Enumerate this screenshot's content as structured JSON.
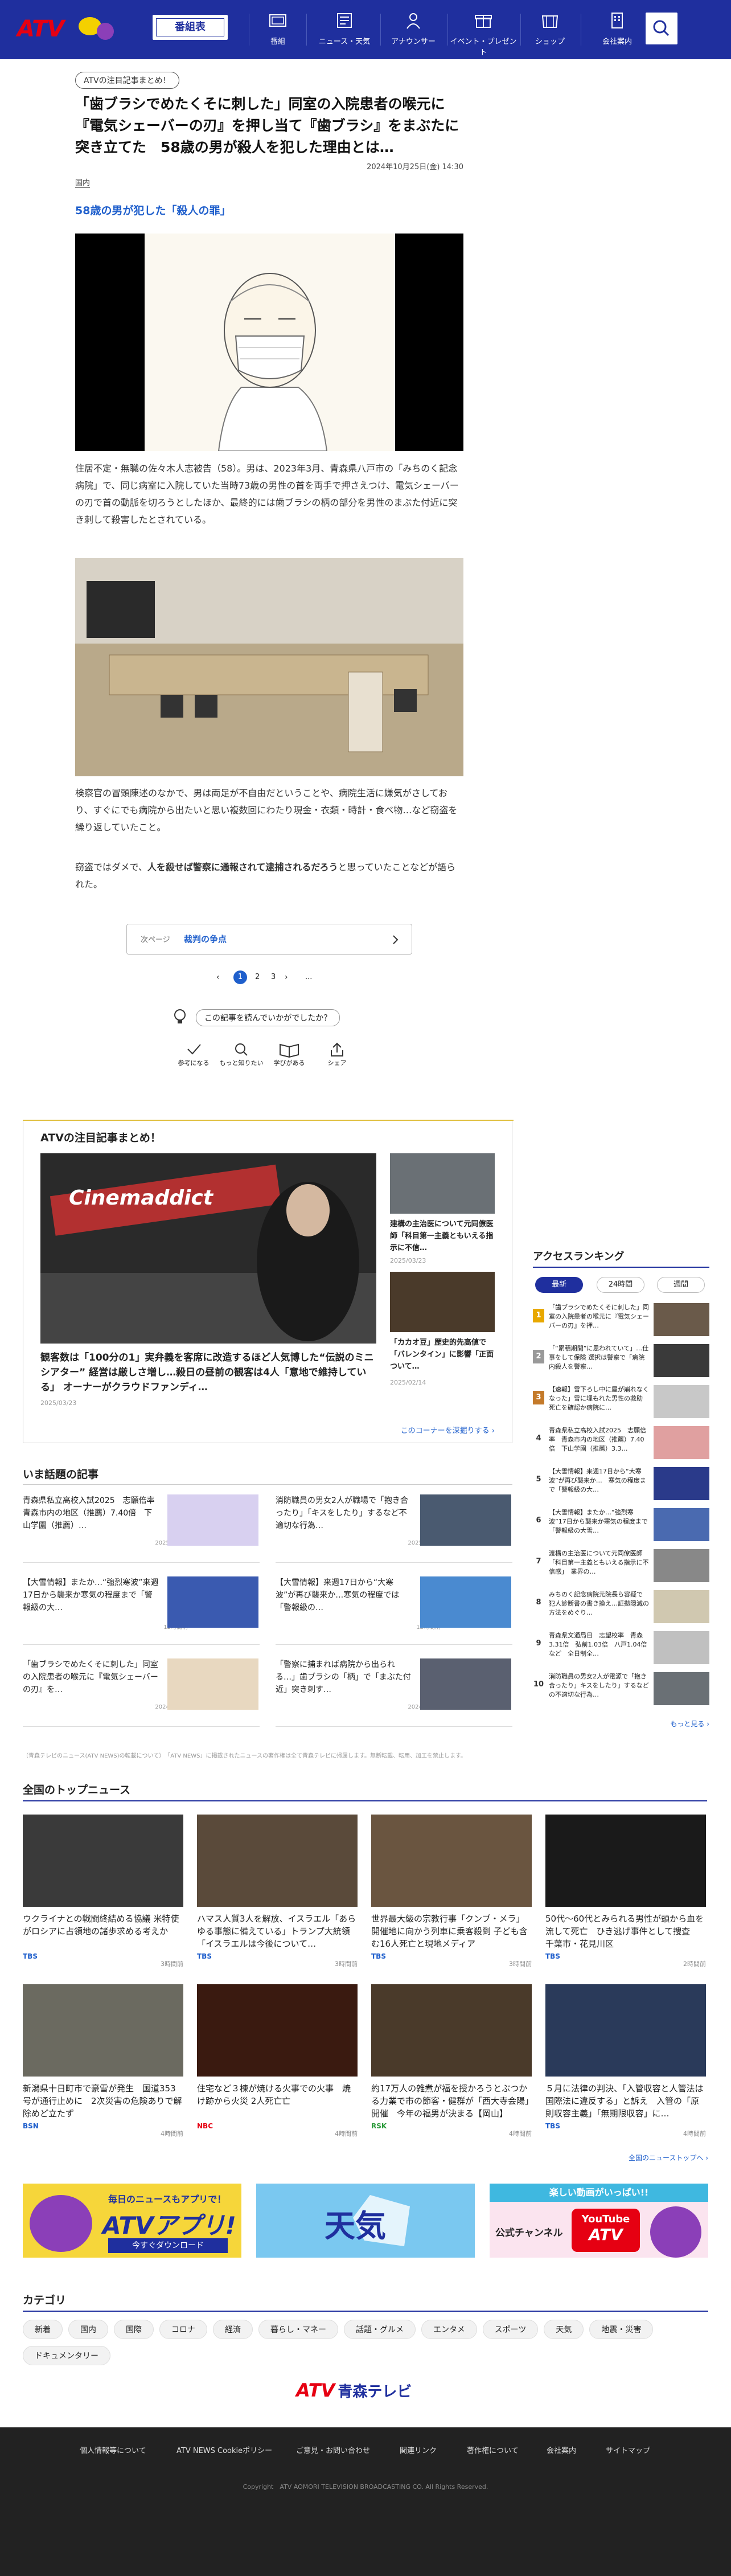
{
  "header": {
    "logo_text": "ATV",
    "program_btn": "番組表",
    "nav": [
      {
        "label": "番組",
        "icon": "tv-icon"
      },
      {
        "label": "ニュース・天気",
        "icon": "newspaper-icon"
      },
      {
        "label": "アナウンサー",
        "icon": "announcer-icon"
      },
      {
        "label": "イベント・プレゼント",
        "icon": "gift-icon"
      },
      {
        "label": "ショップ",
        "icon": "shop-icon"
      },
      {
        "label": "会社案内",
        "icon": "building-icon"
      }
    ]
  },
  "article": {
    "tag": "ATVの注目記事まとめ！",
    "title": "「歯ブラシでめたくそに刺した」同室の入院患者の喉元に『電気シェーバーの刃』を押し当て『歯ブラシ』をまぶたに突き立てた　58歳の男が殺人を犯した理由とは…",
    "date": "2024年10月25日(金) 14:30",
    "category": "国内",
    "subheading": "58歳の男が犯した「殺人の罪」",
    "para1": "住居不定・無職の佐々木人志被告（58）。男は、2023年3月、青森県八戸市の「みちのく記念病院」で、同じ病室に入院していた当時73歳の男性の首を両手で押さえつけ、電気シェーバーの刃で首の動脈を切ろうとしたほか、最終的には歯ブラシの柄の部分を男性のまぶた付近に突き刺して殺害したとされている。",
    "para2a": "検察官の冒頭陳述のなかで、男は両足が不自由だということや、病院生活に嫌気がさしており、すぐにでも病院から出たいと思い複数回にわたり現金・衣類・時計・食べ物…など窃盗を繰り返していたこと。",
    "para2b_pre": "窃盗ではダメで、",
    "para2b_em": "人を殺せば警察に通報されて逮捕されるだろう",
    "para2b_post": "と思っていたことなどが語られた。",
    "next_label": "次ページ",
    "next_title": "裁判の争点",
    "pages": [
      "1",
      "2",
      "3",
      "..."
    ],
    "current_page": "1",
    "rating_q": "この記事を読んでいかがでしたか？",
    "reactions": [
      "参考になる",
      "もっと知りたい",
      "学びがある",
      "シェア"
    ]
  },
  "feature": {
    "title": "ATVの注目記事まとめ！",
    "main_caption": "観客数は「100分の1」実弁義を客席に改造するほど人気博した“伝説のミニシアター” 経営は厳しさ増し…殺日の昼前の観客は4人「意地で維持している」 オーナーがクラウドファンディ…",
    "main_date": "2025/03/23",
    "main_photo_label": "Cinemaddict",
    "side": [
      {
        "title": "建構の主治医について元同僚医師「科目第一主義ともいえる指示に不信…",
        "date": "2025/03/23"
      },
      {
        "title": "「カカオ豆」歴史的先高値で「バレンタイン」に影響「正面ついて…",
        "date": "2025/02/14"
      }
    ],
    "more": "このコーナーを深掘りする ›"
  },
  "ranking": {
    "title": "アクセスランキング",
    "tabs": [
      "最新",
      "24時間",
      "週間"
    ],
    "items": [
      {
        "rank": "1",
        "title": "「歯ブラシでめたくそに刺した」同室の入院患者の喉元に『電気シェーバーの刃』を押…"
      },
      {
        "rank": "2",
        "title": "「“累積期間”に思われていて」…仕事をして保険 選択は警察で「病院内殺人を警察…"
      },
      {
        "rank": "3",
        "title": "【速報】雪下ろし中に屋が崩れなくなった」雪に埋もれた男性の救助 死亡を確認か病院に…"
      },
      {
        "rank": "4",
        "title": "青森県私立高校入試2025　志願倍率　青森市内の地区（推薦）7.40倍　下山学園（推薦）3.3…"
      },
      {
        "rank": "5",
        "title": "【大雪情報】来週17日から“大寒波”が再び襲来か…　寒気の程度まで「警報級の大…"
      },
      {
        "rank": "6",
        "title": "【大雪情報】またか…“強烈寒波”17日から襲来か寒気の程度まで「警報級の大雪…"
      },
      {
        "rank": "7",
        "title": "渡構の主治医について元同僚医師「科目第一主義ともいえる指示に不信感」　業界の…"
      },
      {
        "rank": "8",
        "title": "みちのく記念病院元院長ら容疑で　犯人診断書の書き換え…証拠隠滅の方法をめぐり…"
      },
      {
        "rank": "9",
        "title": "青森県文通局日　志望校率　青森3.31倍　弘前1.03倍　八戸1.04倍など　全日制全…"
      },
      {
        "rank": "10",
        "title": "消防職員の男女2人が電源で「抱き合ったり」キスをしたり」するなどの不適切な行為…"
      }
    ],
    "more": "もっと見る ›"
  },
  "hot": {
    "title": "いま話題の記事",
    "items": [
      {
        "title": "青森県私立高校入試2025　志願倍率　青森市内の地区（推薦）7.40倍　下山学園（推薦）…",
        "date": "2025/01/20"
      },
      {
        "title": "消防職員の男女2人が職場で「抱き合ったり」「キスをしたり」するなど不適切な行為…",
        "date": "2025/02/26"
      },
      {
        "title": "【大雪情報】またか…“強烈寒波”来週17日から襲来か寒気の程度まで「警報級の大…",
        "date": "12時間前"
      },
      {
        "title": "【大雪情報】来週17日から“大寒波”が再び襲来か…寒気の程度では「警報級の…",
        "date": "12時間前"
      },
      {
        "title": "「歯ブラシでめたくそに刺した」同室の入院患者の喉元に『電気シェーバーの刃』を…",
        "date": "2024/10/25"
      },
      {
        "title": "「警察に捕まれば病院から出られる…」歯ブラシの「柄」で「まぶた付近」突き刺す…",
        "date": "2024/07/25"
      }
    ]
  },
  "notice": "（青森テレビのニュース(ATV NEWS)の転載について）　「ATV NEWS」に掲載されたニュースの著作権は全て青森テレビに帰属します。無断転載、転用、加工を禁止します。",
  "top_news": {
    "title": "全国のトップニュース",
    "items": [
      {
        "title": "ウクライナとの戦闘終結める協議 米特使がロシアに占領地の諸歩求める考えか",
        "src": "TBS",
        "time": "3時間前",
        "bg": "#3a3a3a"
      },
      {
        "title": "ハマス人質3人を解放、イスラエル「あらゆる事態に備えている」トランプ大統領「イスラエルは今後について…",
        "src": "TBS",
        "time": "3時間前",
        "bg": "#5a4a3a"
      },
      {
        "title": "世界最大級の宗教行事「クンブ・メラ」開催地に向かう列車に乗客殺到 子ども含む16人死亡と現地メディア",
        "src": "TBS",
        "time": "3時間前",
        "bg": "#6a5540"
      },
      {
        "title": "50代〜60代とみられる男性が頭から血を流して死亡　ひき逃げ事件として捜査　千葉市・花見川区",
        "src": "TBS",
        "time": "2時間前",
        "bg": "#1a1a1a"
      },
      {
        "title": "新潟県十日町市で豪雪が発生　国道353号が通行止めに　2次災害の危険ありで解除めど立たず",
        "src": "BSN",
        "time": "4時間前",
        "bg": "#6b6a60"
      },
      {
        "title": "住宅など３棟が焼ける火事での火事　焼け跡から火災 2人死亡亡",
        "src": "NBC",
        "time": "4時間前",
        "bg": "#3a1a10"
      },
      {
        "title": "約17万人の雑煮が福を授かろうとぶつかる力業で市の節客・健群が「西大寺会陽」開催　今年の福男が決まる【岡山】",
        "src": "RSK",
        "time": "4時間前",
        "bg": "#4a3a2a"
      },
      {
        "title": "５月に法律の判決、「入管収容と人管法は国際法に違反する」と訴え　入管の「原則収容主義」「無期限収容」に…",
        "src": "TBS",
        "time": "4時間前",
        "bg": "#2a3a5a"
      }
    ],
    "more": "全国のニューストップへ ›"
  },
  "banners": [
    {
      "top": "毎日のニュースもアプリで！",
      "main": "ATVアプリ!",
      "btn": "今すぐダウンロード"
    },
    {
      "main": "天気"
    },
    {
      "top": "楽しい動画がいっぱい!!",
      "left": "公式チャンネル",
      "yt": "YouTube",
      "atv": "ATV"
    }
  ],
  "categories": {
    "title": "カテゴリ",
    "items": [
      "新着",
      "国内",
      "国際",
      "コロナ",
      "経済",
      "暮らし・マネー",
      "話題・グルメ",
      "エンタメ",
      "スポーツ",
      "天気",
      "地震・災害",
      "ドキュメンタリー"
    ]
  },
  "footer": {
    "logo_atv": "ATV",
    "logo_text": "青森テレビ",
    "links": [
      "個人情報等について",
      "ATV NEWS Cookieポリシー",
      "ご意見・お問い合わせ",
      "関連リンク",
      "著作権について",
      "会社案内",
      "サイトマップ"
    ],
    "copyright": "Copyright　ATV AOMORI TELEVISION BROADCASTING CO. All Rights Reserved."
  },
  "colors": {
    "brand": "#1f2f9e",
    "accent": "#e60012",
    "link": "#1f5fcc"
  }
}
